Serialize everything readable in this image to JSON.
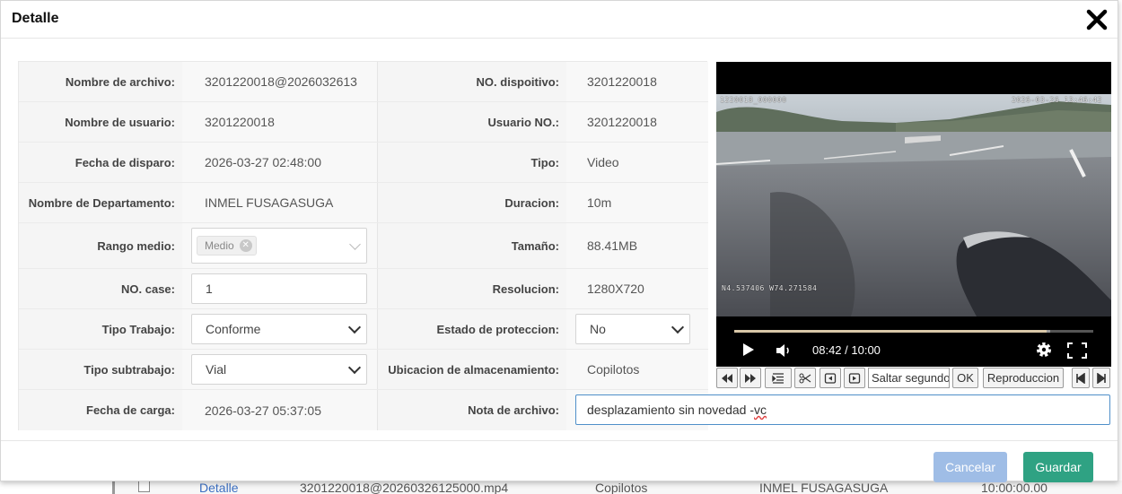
{
  "dialog": {
    "title": "Detalle",
    "close_icon": "close-icon"
  },
  "background_row": {
    "link": "Detalle",
    "filename": "3201220018@20260326125000.mp4",
    "storage": "Copilotos",
    "department": "INMEL FUSAGASUGA",
    "duration": "10:00:00.00"
  },
  "form": {
    "rows": [
      {
        "left_label": "Nombre de archivo:",
        "left_value": "3201220018@2026032613",
        "right_label": "NO. dispoitivo:",
        "right_value": "3201220018"
      },
      {
        "left_label": "Nombre de usuario:",
        "left_value": "3201220018",
        "right_label": "Usuario NO.:",
        "right_value": "3201220018"
      },
      {
        "left_label": "Fecha de disparo:",
        "left_value": "2026-03-27 02:48:00",
        "right_label": "Tipo:",
        "right_value": "Video"
      },
      {
        "left_label": "Nombre de Departamento:",
        "left_value": "INMEL FUSAGASUGA",
        "right_label": "Duracion:",
        "right_value": "10m"
      },
      {
        "left_label": "Rango medio:",
        "left_tag": "Medio",
        "right_label": "Tamaño:",
        "right_value": "88.41MB"
      },
      {
        "left_label": "NO. case:",
        "left_input": "1",
        "right_label": "Resolucion:",
        "right_value": "1280X720"
      },
      {
        "left_label": "Tipo Trabajo:",
        "left_select": "Conforme",
        "right_label": "Estado de proteccion:",
        "right_select": "No"
      },
      {
        "left_label": "Tipo subtrabajo:",
        "left_select": "Vial",
        "right_label": "Ubicacion de almacenamiento:",
        "right_value": "Copilotos"
      },
      {
        "left_label": "Fecha de carga:",
        "left_value": "2026-03-27 05:37:05",
        "right_label": "Nota de archivo:",
        "right_input_main": "desplazamiento sin novedad - ",
        "right_input_tail": "vc"
      }
    ]
  },
  "video": {
    "osd_top_left": "1220018_000000",
    "osd_top_right": "2026-03-26  13:46:42",
    "osd_coords": "N4.537406  W74.271584",
    "time": "08:42 / 10:00",
    "progress": 0.87,
    "buffered": 0.88,
    "icons": [
      "play-icon",
      "volume-icon",
      "gear-icon",
      "fullscreen-icon"
    ]
  },
  "toolbar": {
    "seek_placeholder": "Saltar segundos",
    "ok_label": "OK",
    "playback_label": "Reproduccion",
    "icons": [
      "rewind-icon",
      "fast-forward-icon",
      "list-icon",
      "scissors-icon",
      "frame-back-icon",
      "frame-forward-icon",
      "skip-start-icon",
      "skip-end-icon"
    ]
  },
  "footer": {
    "cancel_label": "Cancelar",
    "save_label": "Guardar"
  },
  "colors": {
    "save": "#2fa283",
    "cancel": "#9fbde6",
    "focus_border": "#4f8fc9"
  }
}
